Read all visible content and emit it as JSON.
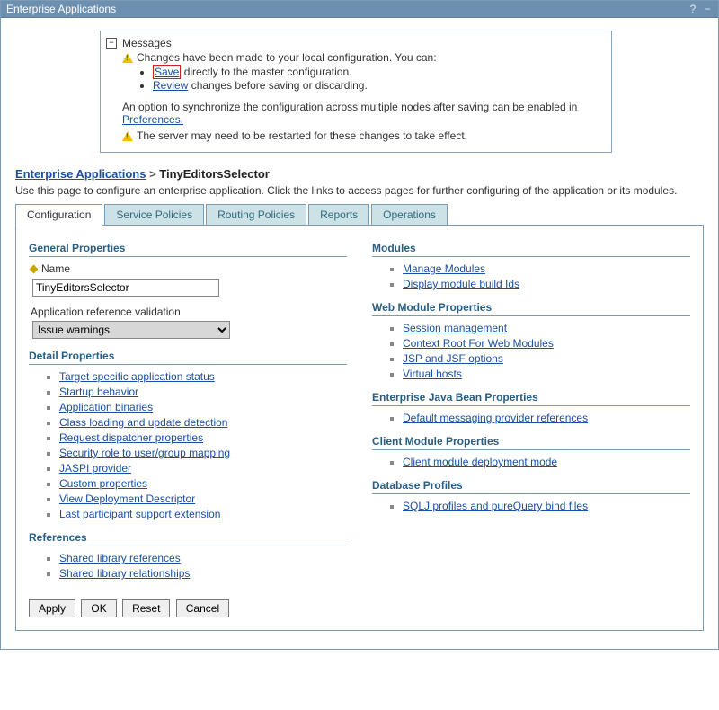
{
  "titlebar": {
    "title": "Enterprise Applications"
  },
  "messages": {
    "header": "Messages",
    "line1": "Changes have been made to your local configuration. You can:",
    "save_link": "Save",
    "save_suffix": " directly to the master configuration.",
    "review_link": "Review",
    "review_suffix": " changes before saving or discarding.",
    "line3a": "An option to synchronize the configuration across multiple nodes after saving can be enabled in ",
    "preferences_link": "Preferences.",
    "line4": "The server may need to be restarted for these changes to take effect."
  },
  "breadcrumb": {
    "parent": "Enterprise Applications",
    "current": "TinyEditorsSelector"
  },
  "page_desc": "Use this page to configure an enterprise application. Click the links to access pages for further configuring of the application or its modules.",
  "tabs": [
    "Configuration",
    "Service Policies",
    "Routing Policies",
    "Reports",
    "Operations"
  ],
  "form": {
    "general_title": "General Properties",
    "name_label": "Name",
    "name_value": "TinyEditorsSelector",
    "validation_label": "Application reference validation",
    "validation_value": "Issue warnings",
    "detail_title": "Detail Properties",
    "detail_links": [
      "Target specific application status",
      "Startup behavior",
      "Application binaries",
      "Class loading and update detection",
      "Request dispatcher properties",
      "Security role to user/group mapping",
      "JASPI provider",
      "Custom properties",
      "View Deployment Descriptor",
      "Last participant support extension"
    ],
    "references_title": "References",
    "references_links": [
      "Shared library references",
      "Shared library relationships"
    ],
    "modules_title": "Modules",
    "modules_links": [
      "Manage Modules",
      "Display module build Ids"
    ],
    "webmod_title": "Web Module Properties",
    "webmod_links": [
      "Session management",
      "Context Root For Web Modules",
      "JSP and JSF options",
      "Virtual hosts"
    ],
    "ejb_title": "Enterprise Java Bean Properties",
    "ejb_links": [
      "Default messaging provider references"
    ],
    "client_title": "Client Module Properties",
    "client_links": [
      "Client module deployment mode"
    ],
    "db_title": "Database Profiles",
    "db_links": [
      "SQLJ profiles and pureQuery bind files"
    ]
  },
  "buttons": {
    "apply": "Apply",
    "ok": "OK",
    "reset": "Reset",
    "cancel": "Cancel"
  }
}
